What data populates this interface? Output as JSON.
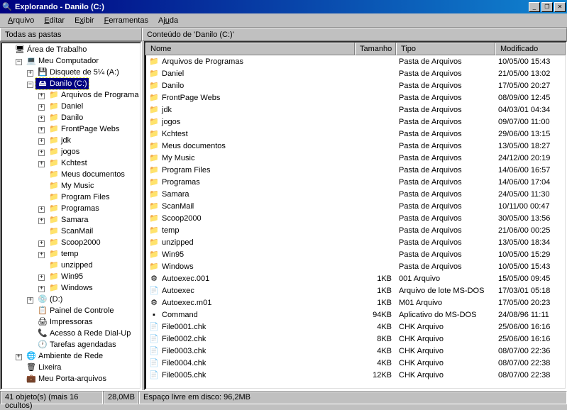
{
  "titlebar": {
    "title": "Explorando - Danilo (C:)"
  },
  "menu": {
    "arquivo": "Arquivo",
    "editar": "Editar",
    "exibir": "Exibir",
    "ferramentas": "Ferramentas",
    "ajuda": "Ajuda"
  },
  "labels": {
    "left": "Todas as pastas",
    "right": "Conteúdo de 'Danilo (C:)'"
  },
  "columns": {
    "name": "Nome",
    "size": "Tamanho",
    "type": "Tipo",
    "modified": "Modificado"
  },
  "tree": {
    "root": "Área de Trabalho",
    "computer": "Meu Computador",
    "floppy": "Disquete de 5¼ (A:)",
    "selected": "Danilo (C:)",
    "c_children": [
      "Arquivos de Programa",
      "Daniel",
      "Danilo",
      "FrontPage Webs",
      "jdk",
      "jogos",
      "Kchtest",
      "Meus documentos",
      "My Music",
      "Program Files",
      "Programas",
      "Samara",
      "ScanMail",
      "Scoop2000",
      "temp",
      "unzipped",
      "Win95",
      "Windows"
    ],
    "c_expandable": [
      true,
      true,
      true,
      true,
      true,
      true,
      true,
      false,
      false,
      false,
      true,
      true,
      false,
      true,
      true,
      false,
      true,
      true
    ],
    "d": "(D:)",
    "panel": "Painel de Controle",
    "printers": "Impressoras",
    "dialup": "Acesso à Rede Dial-Up",
    "tasks": "Tarefas agendadas",
    "network": "Ambiente de Rede",
    "recycle": "Lixeira",
    "briefcase": "Meu Porta-arquivos"
  },
  "files": [
    {
      "icon": "folder-closed",
      "name": "Arquivos de Programas",
      "size": "",
      "type": "Pasta de Arquivos",
      "mod": "10/05/00 15:43"
    },
    {
      "icon": "folder-closed",
      "name": "Daniel",
      "size": "",
      "type": "Pasta de Arquivos",
      "mod": "21/05/00 13:02"
    },
    {
      "icon": "folder-closed",
      "name": "Danilo",
      "size": "",
      "type": "Pasta de Arquivos",
      "mod": "17/05/00 20:27"
    },
    {
      "icon": "folder-closed",
      "name": "FrontPage Webs",
      "size": "",
      "type": "Pasta de Arquivos",
      "mod": "08/09/00 12:45"
    },
    {
      "icon": "folder-closed",
      "name": "jdk",
      "size": "",
      "type": "Pasta de Arquivos",
      "mod": "04/03/01 04:34"
    },
    {
      "icon": "folder-closed",
      "name": "jogos",
      "size": "",
      "type": "Pasta de Arquivos",
      "mod": "09/07/00 11:00"
    },
    {
      "icon": "folder-closed",
      "name": "Kchtest",
      "size": "",
      "type": "Pasta de Arquivos",
      "mod": "29/06/00 13:15"
    },
    {
      "icon": "folder-closed",
      "name": "Meus documentos",
      "size": "",
      "type": "Pasta de Arquivos",
      "mod": "13/05/00 18:27"
    },
    {
      "icon": "folder-closed",
      "name": "My Music",
      "size": "",
      "type": "Pasta de Arquivos",
      "mod": "24/12/00 20:19"
    },
    {
      "icon": "folder-closed",
      "name": "Program Files",
      "size": "",
      "type": "Pasta de Arquivos",
      "mod": "14/06/00 16:57"
    },
    {
      "icon": "folder-closed",
      "name": "Programas",
      "size": "",
      "type": "Pasta de Arquivos",
      "mod": "14/06/00 17:04"
    },
    {
      "icon": "folder-closed",
      "name": "Samara",
      "size": "",
      "type": "Pasta de Arquivos",
      "mod": "24/05/00 11:30"
    },
    {
      "icon": "folder-closed",
      "name": "ScanMail",
      "size": "",
      "type": "Pasta de Arquivos",
      "mod": "10/11/00 00:47"
    },
    {
      "icon": "folder-closed",
      "name": "Scoop2000",
      "size": "",
      "type": "Pasta de Arquivos",
      "mod": "30/05/00 13:56"
    },
    {
      "icon": "folder-closed",
      "name": "temp",
      "size": "",
      "type": "Pasta de Arquivos",
      "mod": "21/06/00 00:25"
    },
    {
      "icon": "folder-closed",
      "name": "unzipped",
      "size": "",
      "type": "Pasta de Arquivos",
      "mod": "13/05/00 18:34"
    },
    {
      "icon": "folder-closed",
      "name": "Win95",
      "size": "",
      "type": "Pasta de Arquivos",
      "mod": "10/05/00 15:29"
    },
    {
      "icon": "folder-closed",
      "name": "Windows",
      "size": "",
      "type": "Pasta de Arquivos",
      "mod": "10/05/00 15:43"
    },
    {
      "icon": "file-sys",
      "name": "Autoexec.001",
      "size": "1KB",
      "type": "001 Arquivo",
      "mod": "15/05/00 09:45"
    },
    {
      "icon": "file-bat",
      "name": "Autoexec",
      "size": "1KB",
      "type": "Arquivo de lote MS-DOS",
      "mod": "17/03/01 05:18"
    },
    {
      "icon": "file-sys",
      "name": "Autoexec.m01",
      "size": "1KB",
      "type": "M01 Arquivo",
      "mod": "17/05/00 20:23"
    },
    {
      "icon": "file-dos",
      "name": "Command",
      "size": "94KB",
      "type": "Aplicativo do MS-DOS",
      "mod": "24/08/96 11:11"
    },
    {
      "icon": "file-chk",
      "name": "File0001.chk",
      "size": "4KB",
      "type": "CHK Arquivo",
      "mod": "25/06/00 16:16"
    },
    {
      "icon": "file-chk",
      "name": "File0002.chk",
      "size": "8KB",
      "type": "CHK Arquivo",
      "mod": "25/06/00 16:16"
    },
    {
      "icon": "file-chk",
      "name": "File0003.chk",
      "size": "4KB",
      "type": "CHK Arquivo",
      "mod": "08/07/00 22:36"
    },
    {
      "icon": "file-chk",
      "name": "File0004.chk",
      "size": "4KB",
      "type": "CHK Arquivo",
      "mod": "08/07/00 22:38"
    },
    {
      "icon": "file-chk",
      "name": "File0005.chk",
      "size": "12KB",
      "type": "CHK Arquivo",
      "mod": "08/07/00 22:38"
    }
  ],
  "status": {
    "objects": "41 objeto(s) (mais 16 ocultos)",
    "size": "28,0MB",
    "disk": "Espaço livre em disco: 96,2MB"
  }
}
